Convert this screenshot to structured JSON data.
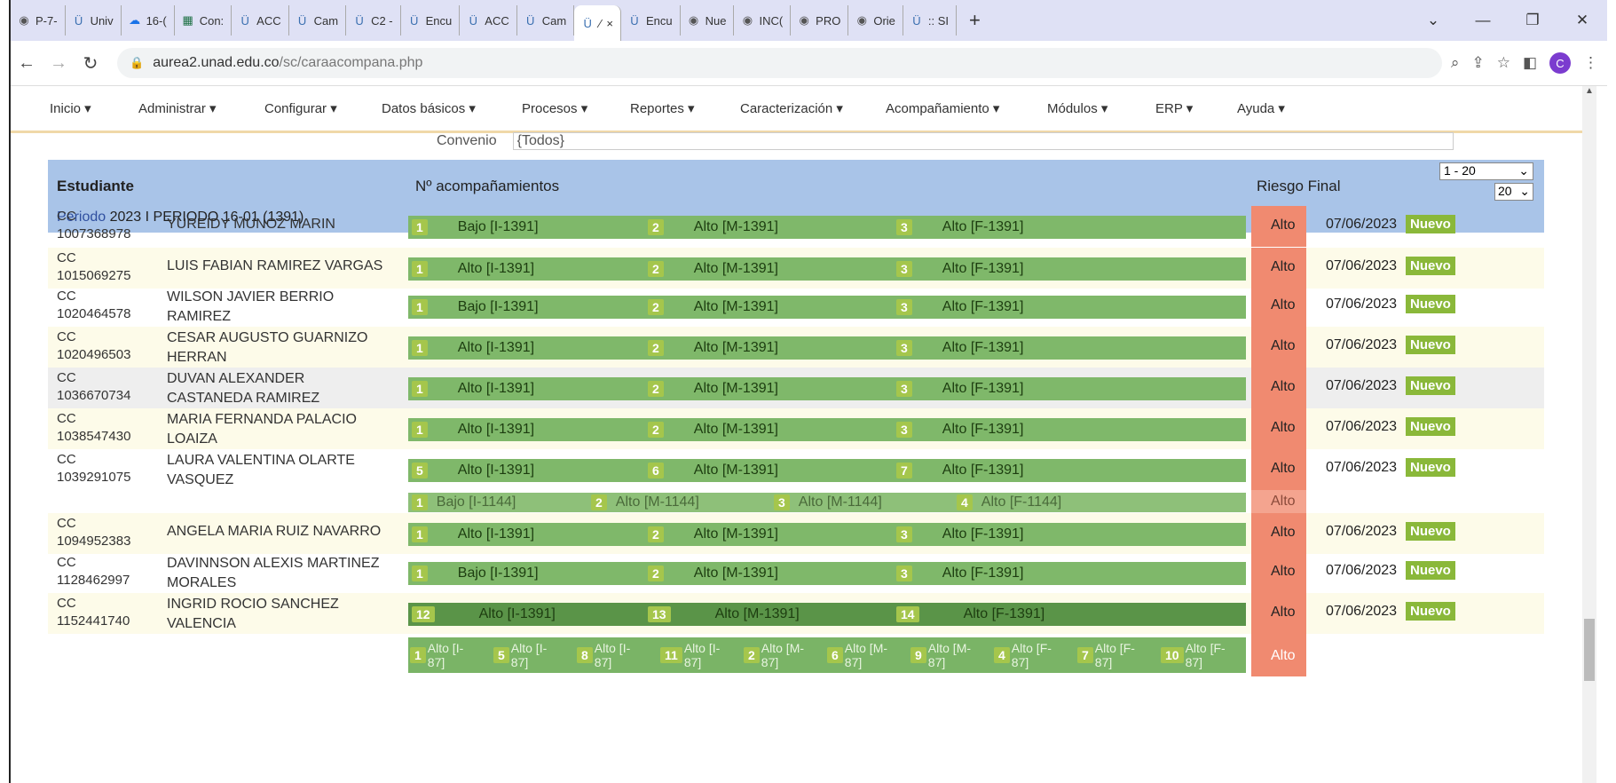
{
  "tabs": [
    {
      "label": "P-7-",
      "icon": "chrome-icon"
    },
    {
      "label": "Univ",
      "icon": "unad-icon"
    },
    {
      "label": "16-(",
      "icon": "cloud-icon"
    },
    {
      "label": "Con:",
      "icon": "excel-icon"
    },
    {
      "label": "ACC",
      "icon": "unad-icon"
    },
    {
      "label": "Cam",
      "icon": "unad-icon"
    },
    {
      "label": "C2 -",
      "icon": "unad-icon"
    },
    {
      "label": "Encu",
      "icon": "unad-icon"
    },
    {
      "label": "ACC",
      "icon": "unad-icon"
    },
    {
      "label": "Cam",
      "icon": "unad-icon"
    },
    {
      "label": "⁄",
      "icon": "unad-icon"
    },
    {
      "label": "Encu",
      "icon": "unad-icon"
    },
    {
      "label": "Nue",
      "icon": "chrome-icon"
    },
    {
      "label": "INC(",
      "icon": "chrome-icon"
    },
    {
      "label": "PRO",
      "icon": "chrome-icon"
    },
    {
      "label": "Orie",
      "icon": "chrome-icon"
    },
    {
      "label": ":: SI",
      "icon": "unad-icon"
    }
  ],
  "active_tab_close": "×",
  "new_tab": "+",
  "window_controls": [
    "⌄",
    "—",
    "❐",
    "✕"
  ],
  "address": {
    "domain": "aurea2.unad.edu.co",
    "path": "/sc/caraacompana.php"
  },
  "avatar_letter": "C",
  "menu": [
    "Inicio ▾",
    "Administrar ▾",
    "Configurar ▾",
    "Datos básicos ▾",
    "Procesos ▾",
    "Reportes ▾",
    "Caracterización ▾",
    "Acompañamiento ▾",
    "Módulos ▾",
    "ERP ▾",
    "Ayuda ▾"
  ],
  "filter": {
    "label": "Convenio",
    "value": "{Todos}"
  },
  "header": {
    "student": "Estudiante",
    "acomp": "Nº acompañamientos",
    "riesgo": "Riesgo Final",
    "range": "1 - 20",
    "page_size": "20"
  },
  "periodo": {
    "prefix": "Periodo ",
    "year": "2023",
    "rest": " I PERIODO 16-01 (1391)"
  },
  "rows": [
    {
      "cc": "CC",
      "id": "1007368978",
      "name1": "YUREIDY MUNOZ MARIN",
      "name2": "",
      "segs": [
        [
          "1",
          "Bajo [I-1391]"
        ],
        [
          "2",
          "Alto [M-1391]"
        ],
        [
          "3",
          "Alto [F-1391]"
        ]
      ],
      "riesgo": "Alto",
      "fecha": "07/06/2023",
      "badge": "Nuevo"
    },
    {
      "cc": "CC",
      "id": "1015069275",
      "name1": "LUIS FABIAN RAMIREZ VARGAS",
      "name2": "",
      "segs": [
        [
          "1",
          "Alto [I-1391]"
        ],
        [
          "2",
          "Alto [M-1391]"
        ],
        [
          "3",
          "Alto [F-1391]"
        ]
      ],
      "riesgo": "Alto",
      "fecha": "07/06/2023",
      "badge": "Nuevo"
    },
    {
      "cc": "CC",
      "id": "1020464578",
      "name1": "WILSON JAVIER BERRIO",
      "name2": "RAMIREZ",
      "segs": [
        [
          "1",
          "Bajo [I-1391]"
        ],
        [
          "2",
          "Alto [M-1391]"
        ],
        [
          "3",
          "Alto [F-1391]"
        ]
      ],
      "riesgo": "Alto",
      "fecha": "07/06/2023",
      "badge": "Nuevo"
    },
    {
      "cc": "CC",
      "id": "1020496503",
      "name1": "CESAR AUGUSTO GUARNIZO",
      "name2": "HERRAN",
      "segs": [
        [
          "1",
          "Alto [I-1391]"
        ],
        [
          "2",
          "Alto [M-1391]"
        ],
        [
          "3",
          "Alto [F-1391]"
        ]
      ],
      "riesgo": "Alto",
      "fecha": "07/06/2023",
      "badge": "Nuevo"
    },
    {
      "cc": "CC",
      "id": "1036670734",
      "name1": "DUVAN ALEXANDER",
      "name2": "CASTANEDA RAMIREZ",
      "segs": [
        [
          "1",
          "Alto [I-1391]"
        ],
        [
          "2",
          "Alto [M-1391]"
        ],
        [
          "3",
          "Alto [F-1391]"
        ]
      ],
      "riesgo": "Alto",
      "fecha": "07/06/2023",
      "badge": "Nuevo"
    },
    {
      "cc": "CC",
      "id": "1038547430",
      "name1": "MARIA FERNANDA PALACIO",
      "name2": "LOAIZA",
      "segs": [
        [
          "1",
          "Alto [I-1391]"
        ],
        [
          "2",
          "Alto [M-1391]"
        ],
        [
          "3",
          "Alto [F-1391]"
        ]
      ],
      "riesgo": "Alto",
      "fecha": "07/06/2023",
      "badge": "Nuevo"
    },
    {
      "cc": "CC",
      "id": "1039291075",
      "name1": "LAURA VALENTINA OLARTE",
      "name2": "VASQUEZ",
      "segs": [
        [
          "5",
          "Alto [I-1391]"
        ],
        [
          "6",
          "Alto [M-1391]"
        ],
        [
          "7",
          "Alto [F-1391]"
        ]
      ],
      "riesgo": "Alto",
      "fecha": "07/06/2023",
      "badge": "Nuevo"
    },
    {
      "cc": "CC",
      "id": "1094952383",
      "name1": "ANGELA MARIA RUIZ NAVARRO",
      "name2": "",
      "segs": [
        [
          "1",
          "Alto [I-1391]"
        ],
        [
          "2",
          "Alto [M-1391]"
        ],
        [
          "3",
          "Alto [F-1391]"
        ]
      ],
      "riesgo": "Alto",
      "fecha": "07/06/2023",
      "badge": "Nuevo"
    },
    {
      "cc": "CC",
      "id": "1128462997",
      "name1": "DAVINNSON ALEXIS MARTINEZ",
      "name2": "MORALES",
      "segs": [
        [
          "1",
          "Bajo [I-1391]"
        ],
        [
          "2",
          "Alto [M-1391]"
        ],
        [
          "3",
          "Alto [F-1391]"
        ]
      ],
      "riesgo": "Alto",
      "fecha": "07/06/2023",
      "badge": "Nuevo"
    },
    {
      "cc": "CC",
      "id": "1152441740",
      "name1": "INGRID ROCIO SANCHEZ",
      "name2": "VALENCIA",
      "segs": [
        [
          "12",
          "Alto [I-1391]"
        ],
        [
          "13",
          "Alto [M-1391]"
        ],
        [
          "14",
          "Alto [F-1391]"
        ]
      ],
      "riesgo": "Alto",
      "fecha": "07/06/2023",
      "badge": "Nuevo"
    }
  ],
  "extra_1144": {
    "segs": [
      [
        "1",
        "Bajo [I-1144]"
      ],
      [
        "2",
        "Alto [M-1144]"
      ],
      [
        "3",
        "Alto [M-1144]"
      ],
      [
        "4",
        "Alto [F-1144]"
      ]
    ],
    "riesgo": "Alto"
  },
  "extra_87": {
    "segs": [
      [
        "1",
        "Alto [I-",
        "87]"
      ],
      [
        "5",
        "Alto [I-",
        "87]"
      ],
      [
        "8",
        "Alto [I-",
        "87]"
      ],
      [
        "11",
        "Alto [I-",
        "87]"
      ],
      [
        "2",
        "Alto [M-",
        "87]"
      ],
      [
        "6",
        "Alto [M-",
        "87]"
      ],
      [
        "9",
        "Alto [M-",
        "87]"
      ],
      [
        "4",
        "Alto [F-",
        "87]"
      ],
      [
        "7",
        "Alto [F-",
        "87]"
      ],
      [
        "10",
        "Alto [F-",
        "87]"
      ]
    ],
    "riesgo": "Alto"
  }
}
